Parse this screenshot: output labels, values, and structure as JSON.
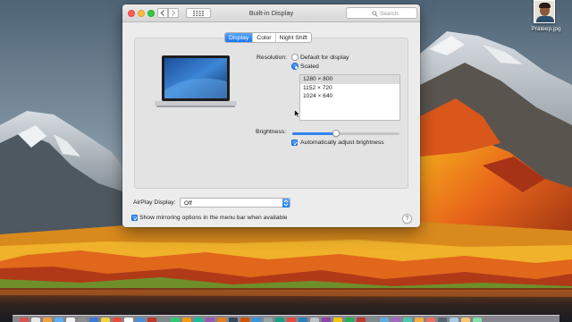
{
  "desktop": {
    "file": {
      "name": "Prateep.jpg",
      "icon": "image-file-icon"
    }
  },
  "window": {
    "title": "Built-in Display",
    "search_placeholder": "Search",
    "tabs": [
      {
        "label": "Display",
        "active": true
      },
      {
        "label": "Color",
        "active": false
      },
      {
        "label": "Night Shift",
        "active": false
      }
    ],
    "resolution": {
      "label": "Resolution:",
      "options": [
        {
          "label": "Default for display",
          "selected": false
        },
        {
          "label": "Scaled",
          "selected": true
        }
      ],
      "list": [
        {
          "label": "1280 × 800",
          "selected": true
        },
        {
          "label": "1152 × 720",
          "selected": false
        },
        {
          "label": "1024 × 640",
          "selected": false
        }
      ]
    },
    "brightness": {
      "label": "Brightness:",
      "level": 0.41,
      "auto_label": "Automatically adjust brightness",
      "auto_checked": true
    },
    "airplay": {
      "label": "AirPlay Display:",
      "value": "Off"
    },
    "mirroring": {
      "label": "Show mirroring options in the menu bar when available",
      "checked": true
    },
    "help": "?"
  },
  "colors": {
    "accent": "#1a76f2",
    "close": "#fc605c",
    "minimize": "#fdbc40",
    "maximize": "#34c84a"
  },
  "dock": {
    "icons": [
      "#d9534f",
      "#e8e8e8",
      "#f0a33a",
      "#5bb0f0",
      "#f2f2f2",
      "#8e8e8e",
      "#3a7bd5",
      "#f4d03f",
      "#e74c3c",
      "#ffffff",
      "#4a90d9",
      "#c0392b",
      "#7f8c8d",
      "#2ecc71",
      "#f39c12",
      "#1abc9c",
      "#9b59b6",
      "#e67e22",
      "#34495e",
      "#d35400",
      "#3498db",
      "#95a5a6",
      "#16a085",
      "#e74c3c",
      "#2980b9",
      "#bdc3c7",
      "#8e44ad",
      "#f1c40f",
      "#27ae60",
      "#c0392b",
      "#7f8c8d",
      "#5dade2",
      "#a569bd",
      "#48c9b0",
      "#f5b041",
      "#ec7063",
      "#566573",
      "#a9cce3",
      "#f8c471",
      "#82e0aa"
    ]
  }
}
